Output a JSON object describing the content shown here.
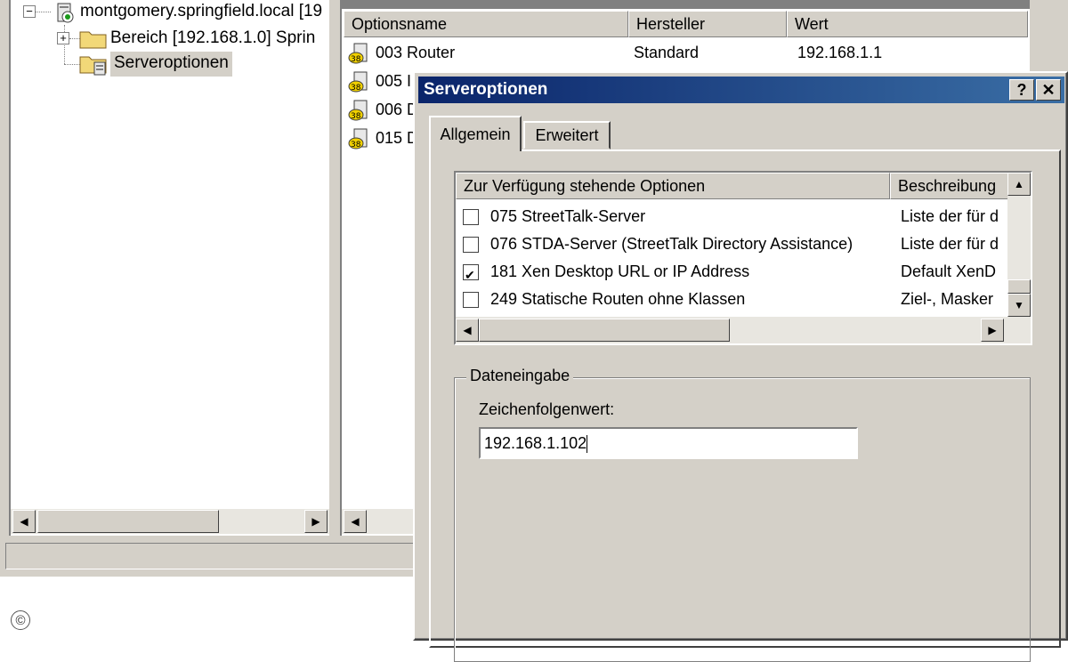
{
  "tree": {
    "root_label": "montgomery.springfield.local [19",
    "scope_label": "Bereich [192.168.1.0] Sprin",
    "server_options_label": "Serveroptionen",
    "expand_glyph": "+",
    "collapse_glyph": "−"
  },
  "options_list": {
    "columns": [
      "Optionsname",
      "Hersteller",
      "Wert"
    ],
    "rows": [
      {
        "name": "003 Router",
        "vendor": "Standard",
        "value": "192.168.1.1"
      },
      {
        "name": "005 I",
        "vendor": "",
        "value": ""
      },
      {
        "name": "006 D",
        "vendor": "",
        "value": ""
      },
      {
        "name": "015 D",
        "vendor": "",
        "value": ""
      }
    ]
  },
  "dialog": {
    "title": "Serveroptionen",
    "help_button": "?",
    "close_button": "✕",
    "tabs": [
      {
        "label": "Allgemein",
        "active": true
      },
      {
        "label": "Erweitert",
        "active": false
      }
    ],
    "available_options": {
      "columns": [
        "Zur Verfügung stehende Optionen",
        "Beschreibung"
      ],
      "rows": [
        {
          "label": "075 StreetTalk-Server",
          "description": "Liste der für d",
          "checked": false
        },
        {
          "label": "076 STDA-Server (StreetTalk Directory Assistance)",
          "description": "Liste der für d",
          "checked": false
        },
        {
          "label": "181 Xen Desktop URL or IP Address",
          "description": "Default XenD",
          "checked": true
        },
        {
          "label": "249 Statische Routen ohne Klassen",
          "description": "Ziel-, Masker",
          "checked": false
        }
      ]
    },
    "data_entry": {
      "group_label": "Dateneingabe",
      "field_label": "Zeichenfolgenwert:",
      "field_value": "192.168.1.102"
    }
  },
  "watermark": "©",
  "colors": {
    "titlebar_start": "#0a246a",
    "titlebar_end": "#3a6ea5",
    "face": "#d4d0c8"
  },
  "icons": {
    "tree_root": "dhcp-server-icon",
    "tree_scope": "folder-icon",
    "tree_options": "server-options-icon",
    "option_row": "option-icon"
  }
}
